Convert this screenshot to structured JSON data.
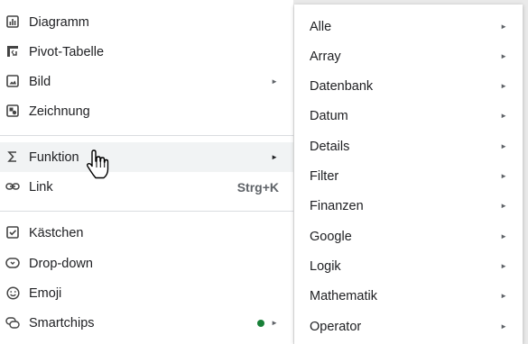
{
  "menu": {
    "items": [
      {
        "label": "Diagramm",
        "icon": "chart-icon"
      },
      {
        "label": "Pivot-Tabelle",
        "icon": "pivot-table-icon"
      },
      {
        "label": "Bild",
        "icon": "image-icon",
        "arrow": "►"
      },
      {
        "label": "Zeichnung",
        "icon": "drawing-icon"
      },
      {
        "label": "Funktion",
        "icon": "sigma-icon",
        "arrow": "►"
      },
      {
        "label": "Link",
        "icon": "link-icon",
        "shortcut": "Strg+K"
      },
      {
        "label": "Kästchen",
        "icon": "checkbox-icon"
      },
      {
        "label": "Drop-down",
        "icon": "dropdown-chip-icon"
      },
      {
        "label": "Emoji",
        "icon": "emoji-icon"
      },
      {
        "label": "Smartchips",
        "icon": "smartchips-icon",
        "arrow": "►",
        "badge_color": "#188038"
      }
    ]
  },
  "submenu": {
    "items": [
      {
        "label": "Alle",
        "arrow": "►"
      },
      {
        "label": "Array",
        "arrow": "►"
      },
      {
        "label": "Datenbank",
        "arrow": "►"
      },
      {
        "label": "Datum",
        "arrow": "►"
      },
      {
        "label": "Details",
        "arrow": "►"
      },
      {
        "label": "Filter",
        "arrow": "►"
      },
      {
        "label": "Finanzen",
        "arrow": "►"
      },
      {
        "label": "Google",
        "arrow": "►"
      },
      {
        "label": "Logik",
        "arrow": "►"
      },
      {
        "label": "Mathematik",
        "arrow": "►"
      },
      {
        "label": "Operator",
        "arrow": "►"
      }
    ]
  },
  "colors": {
    "highlight": "#f1f3f4",
    "separator": "#dadce0",
    "text": "#202124",
    "muted": "#5f6368"
  }
}
